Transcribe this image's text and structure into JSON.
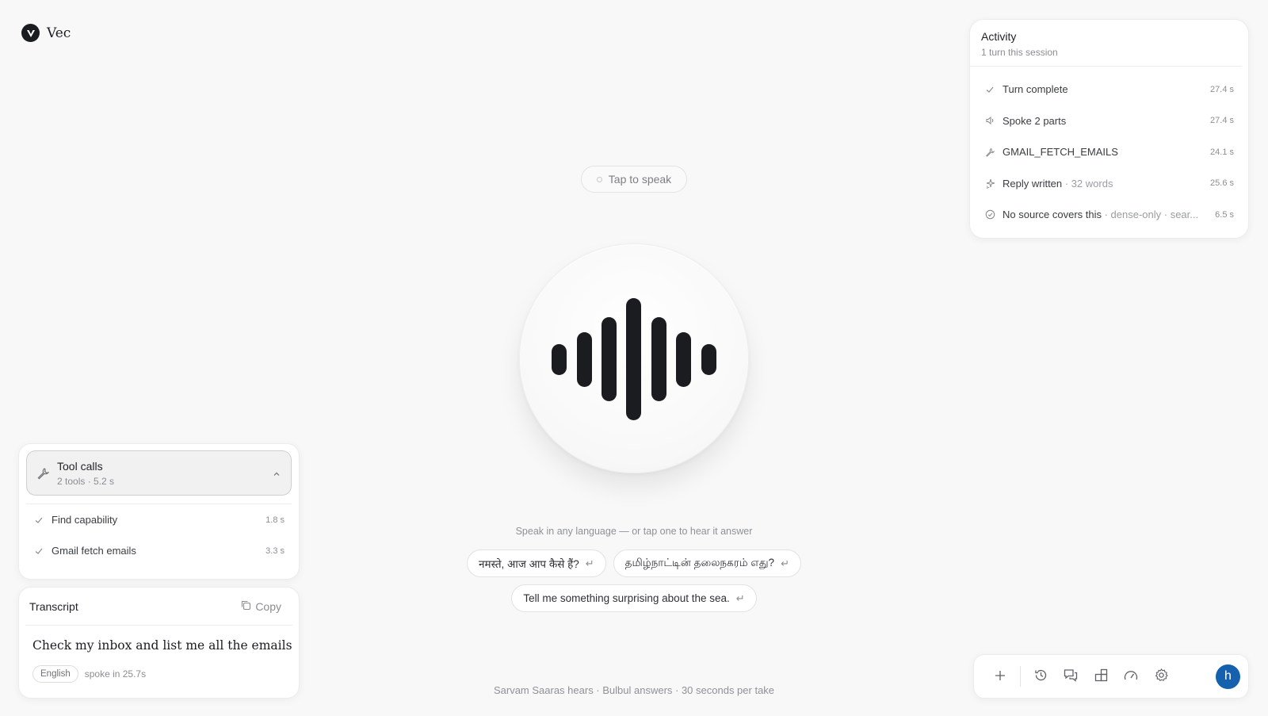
{
  "brand": {
    "name": "Vec"
  },
  "activity": {
    "title": "Activity",
    "subtitle": "1 turn this session",
    "items": [
      {
        "icon": "check-icon",
        "label": "Turn complete",
        "detail": "",
        "time": "27.4 s"
      },
      {
        "icon": "speaker-icon",
        "label": "Spoke 2 parts",
        "detail": "",
        "time": "27.4 s"
      },
      {
        "icon": "wrench-icon",
        "label": "GMAIL_FETCH_EMAILS",
        "detail": "",
        "time": "24.1 s"
      },
      {
        "icon": "sparkle-icon",
        "label": "Reply written",
        "detail": " · 32 words",
        "time": "25.6 s"
      },
      {
        "icon": "no-source-icon",
        "label": "No source covers this",
        "detail": " · dense-only · sear...",
        "time": "6.5 s"
      }
    ]
  },
  "tap_to_speak": "Tap to speak",
  "hint": "Speak in any language — or tap one to hear it answer",
  "suggestions": [
    "नमस्ते, आज आप कैसे हैं?",
    "தமிழ்நாட்டின் தலைநகரம் எது?",
    "Tell me something surprising about the sea."
  ],
  "return_glyph": "↵",
  "footer": "Sarvam Saaras hears · Bulbul answers · 30 seconds per take",
  "tool_calls": {
    "title": "Tool calls",
    "subtitle": "2 tools · 5.2 s",
    "items": [
      {
        "label": "Find capability",
        "time": "1.8 s"
      },
      {
        "label": "Gmail fetch emails",
        "time": "3.3 s"
      }
    ]
  },
  "transcript": {
    "title": "Transcript",
    "copy_label": "Copy",
    "text": "Check my inbox and list me all the emails",
    "language": "English",
    "spoke": "spoke in 25.7s"
  },
  "toolbar": {
    "buttons": [
      "plus-icon",
      "history-icon",
      "chat-icon",
      "apps-icon",
      "gauge-icon",
      "gear-icon"
    ],
    "avatar_initial": "h"
  },
  "colors": {
    "accent_avatar": "#1561ad",
    "wave_bars": "#1b1c1f"
  }
}
